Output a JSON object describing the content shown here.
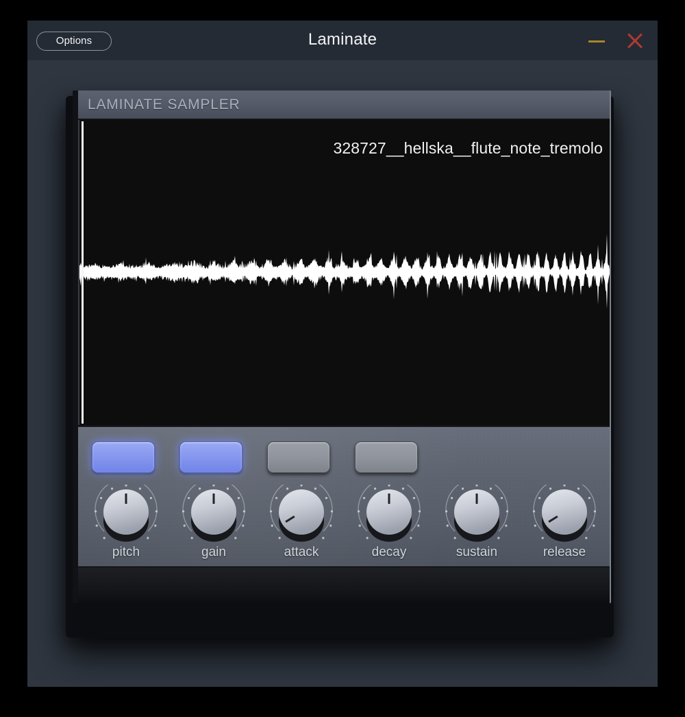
{
  "window": {
    "title": "Laminate",
    "options_label": "Options",
    "minimize_icon": "minimize-dash-icon",
    "close_icon": "close-x-icon",
    "minimize_color": "#a8862a",
    "close_color": "#b03a32",
    "titlebar_color": "#252b34",
    "body_color": "#2f3640"
  },
  "plugin": {
    "header_title": "LAMINATE SAMPLER",
    "sample_name": "328727__hellska__flute_note_tremolo",
    "waveform": {
      "color": "#ffffff",
      "background": "#0d0d0d",
      "playhead_position": 0
    },
    "buttons": [
      {
        "name": "pad-button-1",
        "state": "on",
        "color": "#8596ee"
      },
      {
        "name": "pad-button-2",
        "state": "on",
        "color": "#8596ee"
      },
      {
        "name": "pad-button-3",
        "state": "off",
        "color": "#8f949d"
      },
      {
        "name": "pad-button-4",
        "state": "off",
        "color": "#8f949d"
      }
    ],
    "knobs": [
      {
        "label": "pitch",
        "angle": 0
      },
      {
        "label": "gain",
        "angle": 0
      },
      {
        "label": "attack",
        "angle": -122
      },
      {
        "label": "decay",
        "angle": 0
      },
      {
        "label": "sustain",
        "angle": 0
      },
      {
        "label": "release",
        "angle": -122
      }
    ]
  }
}
